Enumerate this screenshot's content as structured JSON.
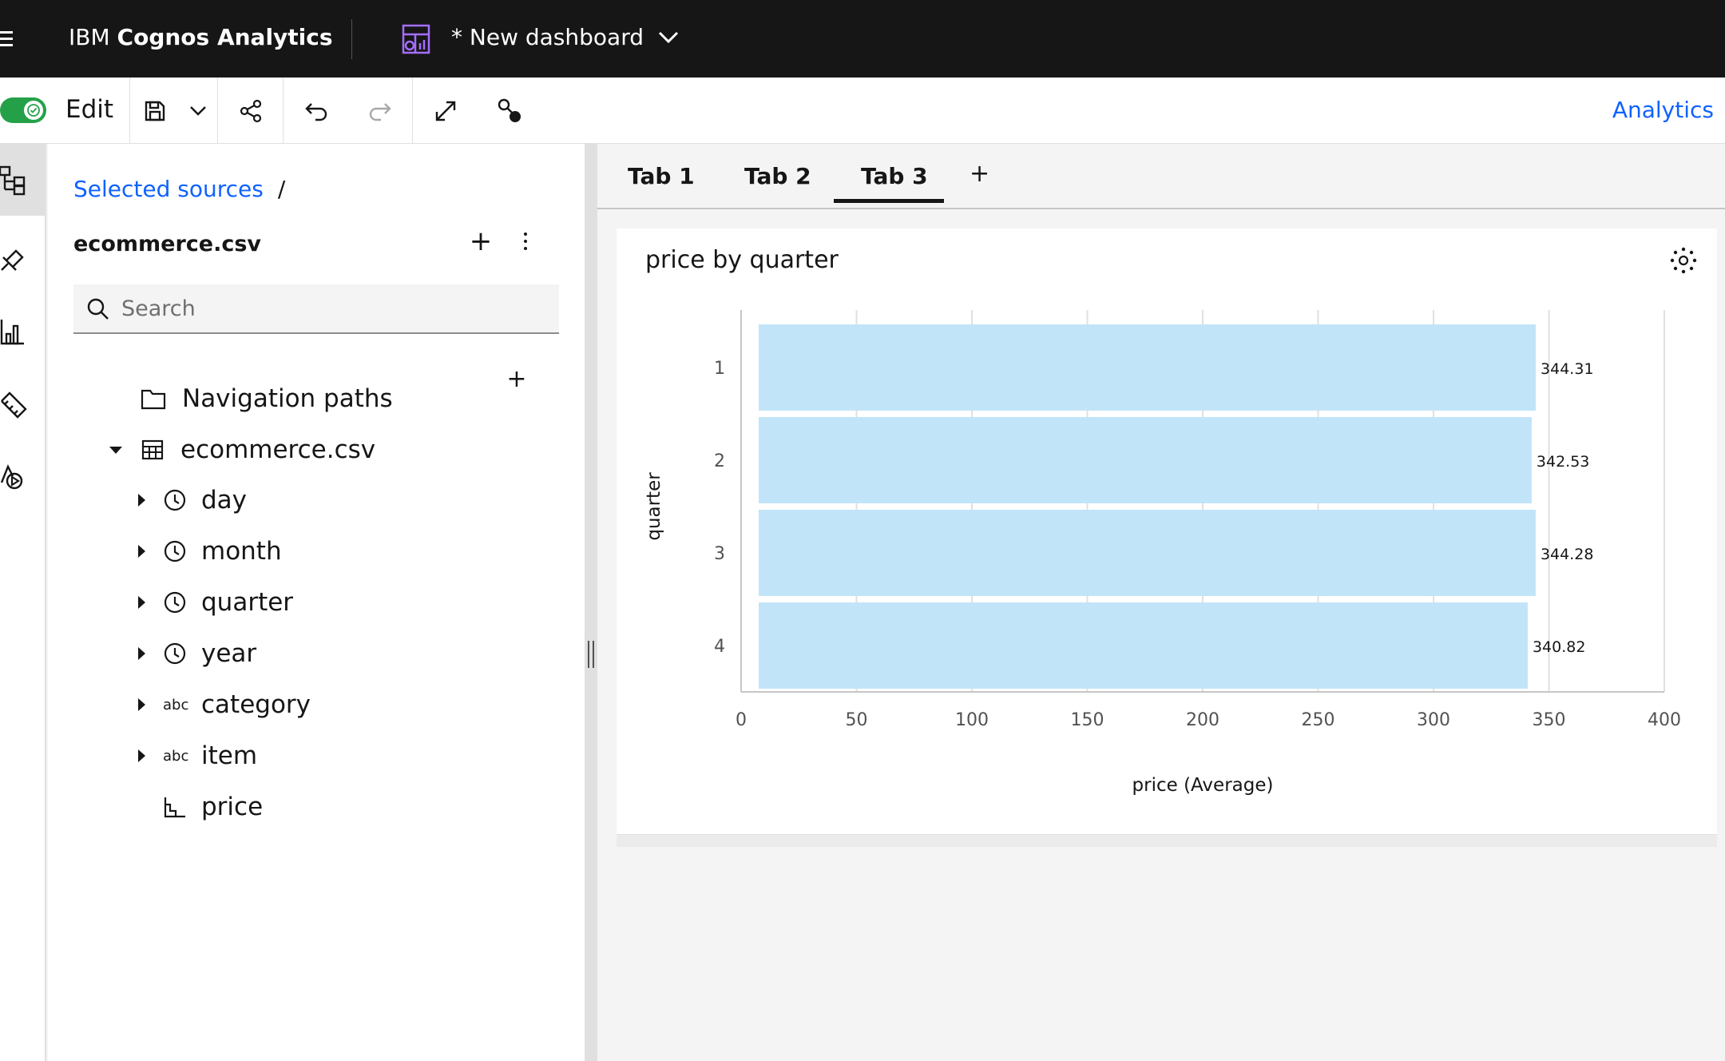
{
  "header": {
    "brand_prefix": "IBM",
    "brand_product": "Cognos Analytics",
    "dashboard_title": "* New dashboard"
  },
  "toolbar": {
    "edit_label": "Edit",
    "edit_enabled": true,
    "analytics_link": "Analytics"
  },
  "rail": {
    "items": [
      "sources-icon",
      "pin-icon",
      "visualizations-icon",
      "widgets-icon",
      "assistant-icon"
    ]
  },
  "panel": {
    "breadcrumb_link": "Selected sources",
    "breadcrumb_separator": "/",
    "source_name": "ecommerce.csv",
    "search_placeholder": "Search",
    "tree": [
      {
        "label": "Navigation paths",
        "icon": "folder-icon"
      },
      {
        "label": "ecommerce.csv",
        "icon": "table-icon",
        "expanded": true
      },
      {
        "label": "day",
        "icon": "clock-icon"
      },
      {
        "label": "month",
        "icon": "clock-icon"
      },
      {
        "label": "quarter",
        "icon": "clock-icon"
      },
      {
        "label": "year",
        "icon": "clock-icon"
      },
      {
        "label": "category",
        "icon": "text-icon",
        "icon_text": "abc"
      },
      {
        "label": "item",
        "icon": "text-icon",
        "icon_text": "abc"
      },
      {
        "label": "price",
        "icon": "measure-icon"
      }
    ]
  },
  "tabs": [
    {
      "label": "Tab 1"
    },
    {
      "label": "Tab 2"
    },
    {
      "label": "Tab 3",
      "active": true
    }
  ],
  "tab_add_label": "+",
  "widget": {
    "title": "price by quarter"
  },
  "colors": {
    "bar_fill": "#c2e4f9",
    "accent": "#0f62fe",
    "toggle_on": "#24a148",
    "header_bg": "#161616"
  },
  "chart_data": {
    "type": "bar",
    "orientation": "horizontal",
    "categories": [
      "1",
      "2",
      "3",
      "4"
    ],
    "values": [
      344.31,
      342.53,
      344.28,
      340.82
    ],
    "value_labels": [
      "344.31",
      "342.53",
      "344.28",
      "340.82"
    ],
    "xlabel": "price (Average)",
    "ylabel": "quarter",
    "xlim": [
      0,
      400
    ],
    "xticks": [
      "0",
      "50",
      "100",
      "150",
      "200",
      "250",
      "300",
      "350",
      "400"
    ],
    "grid": true
  }
}
